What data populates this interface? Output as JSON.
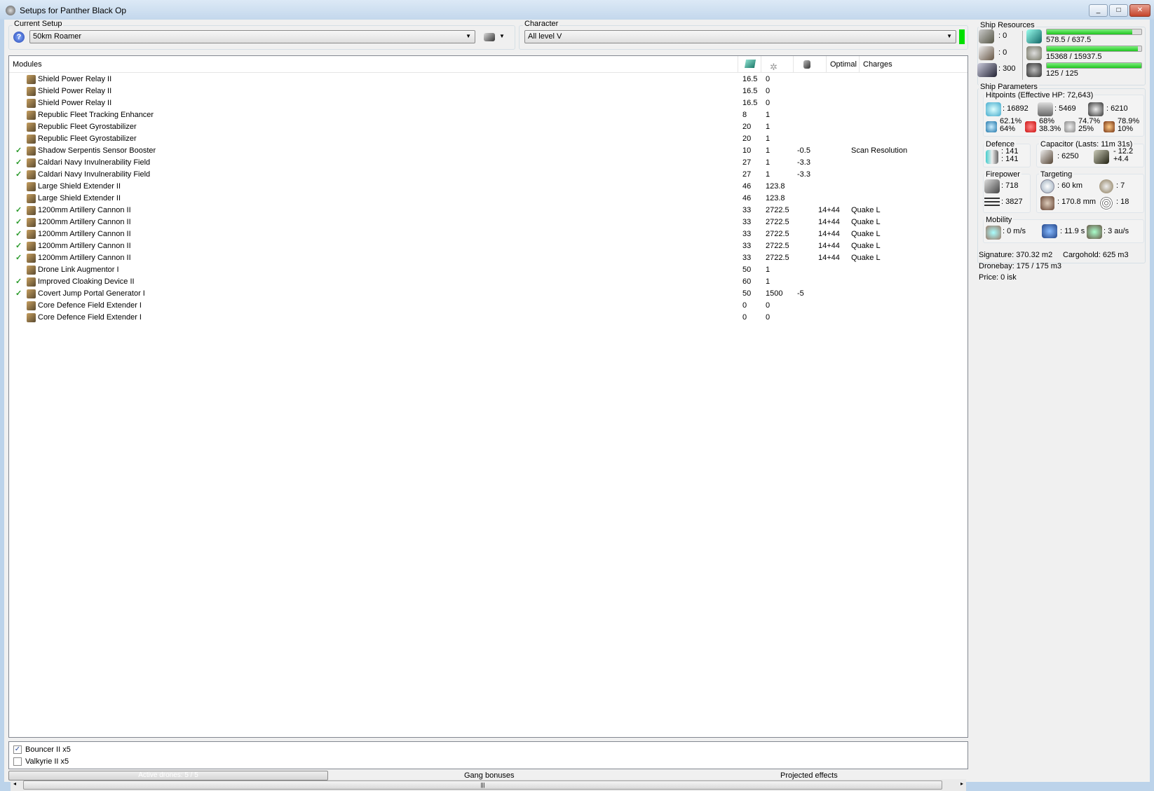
{
  "window": {
    "title": "Setups for Panther Black Op",
    "min": "_",
    "max": "□",
    "close": "✕"
  },
  "setup": {
    "label": "Current Setup",
    "value": "50km Roamer"
  },
  "character": {
    "label": "Character",
    "value": "All level V",
    "status_color": "#00e000"
  },
  "modules": {
    "columns": [
      "Modules",
      "cpu-icon",
      "powergrid-icon",
      "capacitor-icon",
      "Optimal",
      "Charges"
    ],
    "rows": [
      {
        "active": false,
        "name": "Shield Power Relay II",
        "cpu": "16.5",
        "pg": "0",
        "cap": "",
        "optimal": "",
        "charges": ""
      },
      {
        "active": false,
        "name": "Shield Power Relay II",
        "cpu": "16.5",
        "pg": "0",
        "cap": "",
        "optimal": "",
        "charges": ""
      },
      {
        "active": false,
        "name": "Shield Power Relay II",
        "cpu": "16.5",
        "pg": "0",
        "cap": "",
        "optimal": "",
        "charges": ""
      },
      {
        "active": false,
        "name": "Republic Fleet Tracking Enhancer",
        "cpu": "8",
        "pg": "1",
        "cap": "",
        "optimal": "",
        "charges": ""
      },
      {
        "active": false,
        "name": "Republic Fleet Gyrostabilizer",
        "cpu": "20",
        "pg": "1",
        "cap": "",
        "optimal": "",
        "charges": ""
      },
      {
        "active": false,
        "name": "Republic Fleet Gyrostabilizer",
        "cpu": "20",
        "pg": "1",
        "cap": "",
        "optimal": "",
        "charges": ""
      },
      {
        "active": true,
        "name": "Shadow Serpentis Sensor Booster",
        "cpu": "10",
        "pg": "1",
        "cap": "-0.5",
        "optimal": "",
        "charges": "Scan Resolution"
      },
      {
        "active": true,
        "name": "Caldari Navy Invulnerability Field",
        "cpu": "27",
        "pg": "1",
        "cap": "-3.3",
        "optimal": "",
        "charges": ""
      },
      {
        "active": true,
        "name": "Caldari Navy Invulnerability Field",
        "cpu": "27",
        "pg": "1",
        "cap": "-3.3",
        "optimal": "",
        "charges": ""
      },
      {
        "active": false,
        "name": "Large Shield Extender II",
        "cpu": "46",
        "pg": "123.8",
        "cap": "",
        "optimal": "",
        "charges": ""
      },
      {
        "active": false,
        "name": "Large Shield Extender II",
        "cpu": "46",
        "pg": "123.8",
        "cap": "",
        "optimal": "",
        "charges": ""
      },
      {
        "active": true,
        "name": "1200mm Artillery Cannon II",
        "cpu": "33",
        "pg": "2722.5",
        "cap": "",
        "optimal": "14+44",
        "charges": "Quake L"
      },
      {
        "active": true,
        "name": "1200mm Artillery Cannon II",
        "cpu": "33",
        "pg": "2722.5",
        "cap": "",
        "optimal": "14+44",
        "charges": "Quake L"
      },
      {
        "active": true,
        "name": "1200mm Artillery Cannon II",
        "cpu": "33",
        "pg": "2722.5",
        "cap": "",
        "optimal": "14+44",
        "charges": "Quake L"
      },
      {
        "active": true,
        "name": "1200mm Artillery Cannon II",
        "cpu": "33",
        "pg": "2722.5",
        "cap": "",
        "optimal": "14+44",
        "charges": "Quake L"
      },
      {
        "active": true,
        "name": "1200mm Artillery Cannon II",
        "cpu": "33",
        "pg": "2722.5",
        "cap": "",
        "optimal": "14+44",
        "charges": "Quake L"
      },
      {
        "active": false,
        "name": "Drone Link Augmentor I",
        "cpu": "50",
        "pg": "1",
        "cap": "",
        "optimal": "",
        "charges": ""
      },
      {
        "active": true,
        "name": "Improved Cloaking Device II",
        "cpu": "60",
        "pg": "1",
        "cap": "",
        "optimal": "",
        "charges": ""
      },
      {
        "active": true,
        "name": "Covert Jump Portal Generator I",
        "cpu": "50",
        "pg": "1500",
        "cap": "-5",
        "optimal": "",
        "charges": ""
      },
      {
        "active": false,
        "name": "Core Defence Field Extender I",
        "cpu": "0",
        "pg": "0",
        "cap": "",
        "optimal": "",
        "charges": ""
      },
      {
        "active": false,
        "name": "Core Defence Field Extender I",
        "cpu": "0",
        "pg": "0",
        "cap": "",
        "optimal": "",
        "charges": ""
      }
    ]
  },
  "drones": [
    {
      "checked": true,
      "label": "Bouncer II x5"
    },
    {
      "checked": false,
      "label": "Valkyrie II x5"
    }
  ],
  "bottom": {
    "active_drones": "Active drones: 5 / 5",
    "gang": "Gang bonuses",
    "projected": "Projected effects"
  },
  "resources": {
    "title": "Ship Resources",
    "turret": ": 0",
    "launcher": ": 0",
    "calibration": ": 300",
    "cpu": {
      "text": "578.5 / 637.5",
      "fraction": 0.907
    },
    "powergrid": {
      "text": "15368 / 15937.5",
      "fraction": 0.964
    },
    "drone_bw": {
      "text": "125 / 125",
      "fraction": 1.0
    }
  },
  "params": {
    "title": "Ship Parameters",
    "hp_title": "Hitpoints (Effective HP: 72,643)",
    "shield": ": 16892",
    "armor": ": 5469",
    "structure": ": 6210",
    "em": [
      "62.1%",
      "64%"
    ],
    "thermal": [
      "68%",
      "38.3%"
    ],
    "kinetic": [
      "74.7%",
      "25%"
    ],
    "explosive": [
      "78.9%",
      "10%"
    ],
    "defence_title": "Defence",
    "defence": [
      ": 141",
      ": 141"
    ],
    "cap_title": "Capacitor (Lasts: 11m 31s)",
    "cap": ": 6250",
    "cap_delta": [
      "- 12.2",
      "+4.4"
    ],
    "fire_title": "Firepower",
    "dps": ": 718",
    "volley": ": 3827",
    "target_title": "Targeting",
    "range": ": 60 km",
    "targets": ": 7",
    "scanres": ": 170.8 mm",
    "sensor": ": 18",
    "mob_title": "Mobility",
    "speed": ": 0 m/s",
    "align": ": 11.9 s",
    "warp": ": 3 au/s",
    "signature": "Signature: 370.32 m2",
    "cargo": "Cargohold: 625 m3",
    "dronebay": "Dronebay: 175 / 175 m3",
    "price": "Price: 0 isk"
  }
}
